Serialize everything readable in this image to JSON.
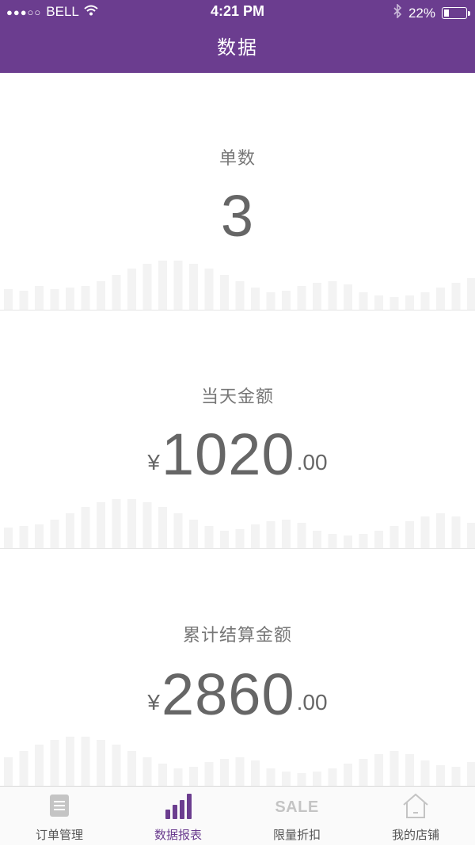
{
  "status_bar": {
    "carrier": "BELL",
    "signal": "●●●○○",
    "time": "4:21 PM",
    "battery": "22%",
    "battery_level": 0.22
  },
  "nav": {
    "title": "数据"
  },
  "stats": [
    {
      "label": "单数",
      "currency": "",
      "integer": "3",
      "decimal": ""
    },
    {
      "label": "当天金额",
      "currency": "¥",
      "integer": "1020",
      "decimal": ".00"
    },
    {
      "label": "累计结算金额",
      "currency": "¥",
      "integer": "2860",
      "decimal": ".00"
    }
  ],
  "tabs": [
    {
      "label": "订单管理",
      "icon": "document-icon",
      "active": false
    },
    {
      "label": "数据报表",
      "icon": "bar-chart-icon",
      "active": true
    },
    {
      "label": "限量折扣",
      "icon": "sale-icon",
      "icon_text": "SALE",
      "active": false
    },
    {
      "label": "我的店铺",
      "icon": "house-icon",
      "active": false
    }
  ],
  "colors": {
    "brand": "#6b3d8f",
    "tab_inactive_icon": "#c4c4c4",
    "background_bars": "#f3f3f3"
  }
}
